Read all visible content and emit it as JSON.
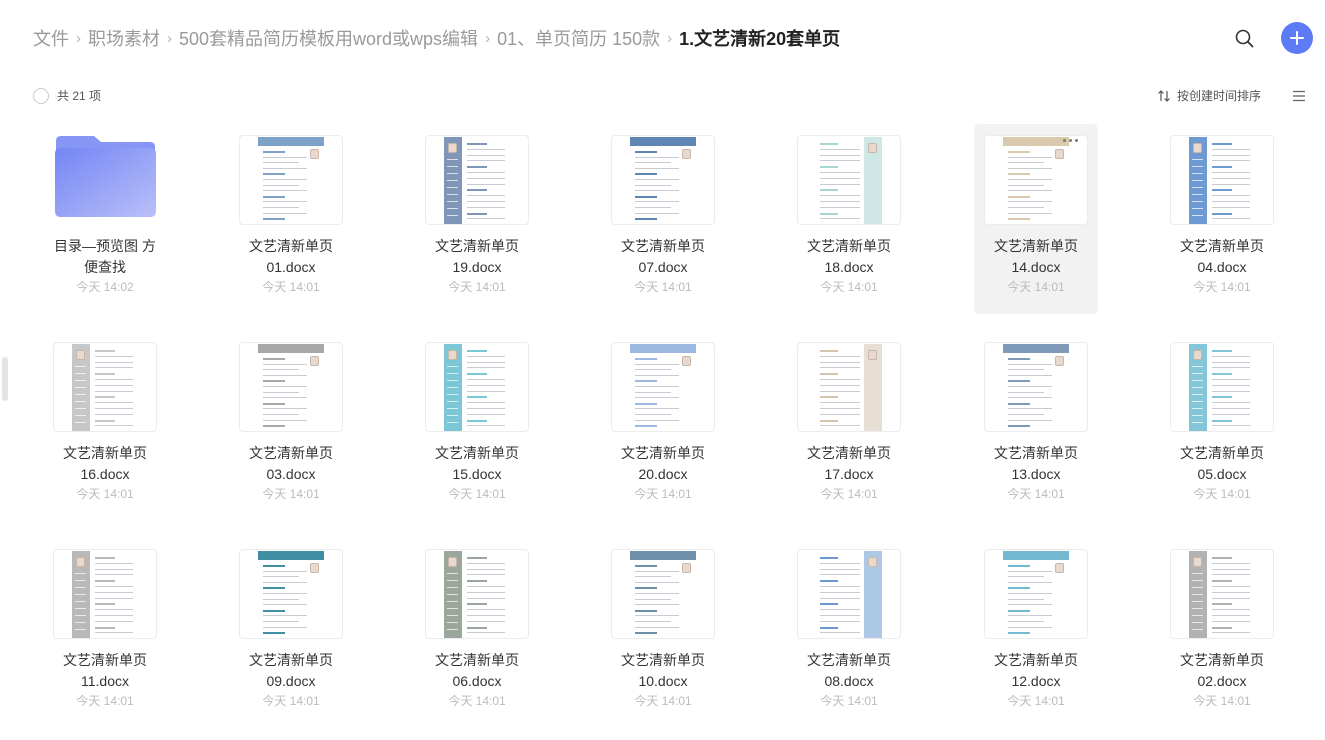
{
  "breadcrumb": {
    "items": [
      "文件",
      "职场素材",
      "500套精品简历模板用word或wps编辑",
      "01、单页简历 150款"
    ],
    "current": "1.文艺清新20套单页",
    "separator": "›"
  },
  "toolbar": {
    "item_count": "共 21 项",
    "sort_label": "按创建时间排序"
  },
  "colors": {
    "accent": "#5e7bf7",
    "folder": "#7e8ff7"
  },
  "files": [
    {
      "line1": "目录—预览图 方",
      "line2": "便查找",
      "date": "今天 14:02",
      "type": "folder"
    },
    {
      "line1": "文艺清新单页",
      "line2": "01.docx",
      "date": "今天 14:01",
      "type": "docx",
      "thumb_color": "#7ea1c8"
    },
    {
      "line1": "文艺清新单页",
      "line2": "19.docx",
      "date": "今天 14:01",
      "type": "docx",
      "thumb_color": "#7f96b8"
    },
    {
      "line1": "文艺清新单页",
      "line2": "07.docx",
      "date": "今天 14:01",
      "type": "docx",
      "thumb_color": "#5f86b2"
    },
    {
      "line1": "文艺清新单页",
      "line2": "18.docx",
      "date": "今天 14:01",
      "type": "docx",
      "thumb_color": "#a7d6d0"
    },
    {
      "line1": "文艺清新单页",
      "line2": "14.docx",
      "date": "今天 14:01",
      "type": "docx",
      "thumb_color": "#d9c9ad"
    },
    {
      "line1": "文艺清新单页",
      "line2": "04.docx",
      "date": "今天 14:01",
      "type": "docx",
      "thumb_color": "#6d9ad3"
    },
    {
      "line1": "文艺清新单页",
      "line2": "16.docx",
      "date": "今天 14:01",
      "type": "docx",
      "thumb_color": "#c7c7c7"
    },
    {
      "line1": "文艺清新单页",
      "line2": "03.docx",
      "date": "今天 14:01",
      "type": "docx",
      "thumb_color": "#a8a8a8"
    },
    {
      "line1": "文艺清新单页",
      "line2": "15.docx",
      "date": "今天 14:01",
      "type": "docx",
      "thumb_color": "#7bc7d6"
    },
    {
      "line1": "文艺清新单页",
      "line2": "20.docx",
      "date": "今天 14:01",
      "type": "docx",
      "thumb_color": "#9cb8e0"
    },
    {
      "line1": "文艺清新单页",
      "line2": "17.docx",
      "date": "今天 14:01",
      "type": "docx",
      "thumb_color": "#d4c4ae"
    },
    {
      "line1": "文艺清新单页",
      "line2": "13.docx",
      "date": "今天 14:01",
      "type": "docx",
      "thumb_color": "#7f99b9"
    },
    {
      "line1": "文艺清新单页",
      "line2": "05.docx",
      "date": "今天 14:01",
      "type": "docx",
      "thumb_color": "#84c5d7"
    },
    {
      "line1": "文艺清新单页",
      "line2": "11.docx",
      "date": "今天 14:01",
      "type": "docx",
      "thumb_color": "#b9b9b9"
    },
    {
      "line1": "文艺清新单页",
      "line2": "09.docx",
      "date": "今天 14:01",
      "type": "docx",
      "thumb_color": "#3f8ea3"
    },
    {
      "line1": "文艺清新单页",
      "line2": "06.docx",
      "date": "今天 14:01",
      "type": "docx",
      "thumb_color": "#9aa79a"
    },
    {
      "line1": "文艺清新单页",
      "line2": "10.docx",
      "date": "今天 14:01",
      "type": "docx",
      "thumb_color": "#6e8fa8"
    },
    {
      "line1": "文艺清新单页",
      "line2": "08.docx",
      "date": "今天 14:01",
      "type": "docx",
      "thumb_color": "#6a9ad0"
    },
    {
      "line1": "文艺清新单页",
      "line2": "12.docx",
      "date": "今天 14:01",
      "type": "docx",
      "thumb_color": "#72b9d1"
    },
    {
      "line1": "文艺清新单页",
      "line2": "02.docx",
      "date": "今天 14:01",
      "type": "docx",
      "thumb_color": "#b2b2b2"
    }
  ]
}
